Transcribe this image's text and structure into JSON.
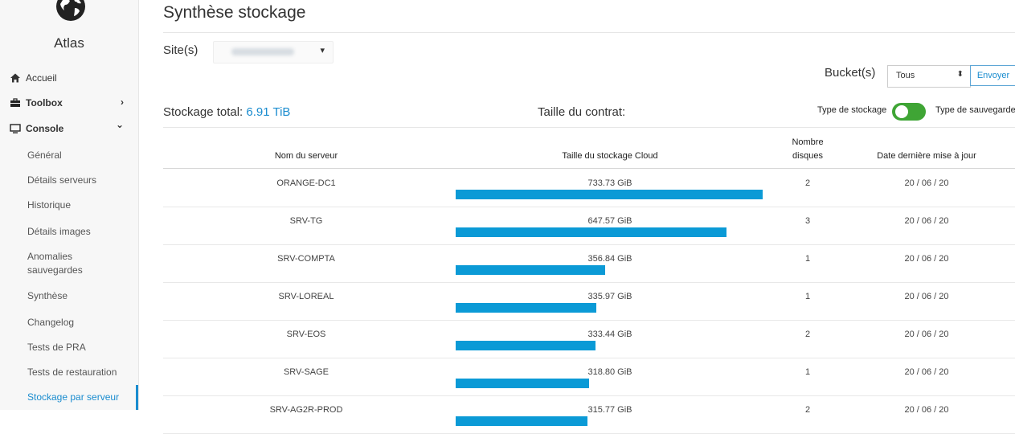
{
  "app": {
    "name": "Atlas",
    "logo_icon": "globe-icon"
  },
  "sidebar": {
    "top_items": [
      {
        "label": "Accueil",
        "icon": "home-icon"
      },
      {
        "label": "Toolbox",
        "icon": "briefcase-icon",
        "chevron": "›"
      },
      {
        "label": "Console",
        "icon": "monitor-icon",
        "chevron": "⌄"
      }
    ],
    "sub_items": [
      "Général",
      "Détails serveurs",
      "Historique",
      "Détails images",
      "Anomalies sauvegardes",
      "Synthèse",
      "Changelog",
      "Tests de PRA",
      "Tests de restauration",
      "Stockage par serveur"
    ],
    "active_index": 9
  },
  "page": {
    "title": "Synthèse stockage"
  },
  "site": {
    "label": "Site(s)",
    "caret": "▾"
  },
  "bucket": {
    "label": "Bucket(s)",
    "selected": "Tous",
    "caret": "⬍",
    "submit": "Envoyer"
  },
  "summary": {
    "total_label": "Stockage total: ",
    "total_value": "6.91 TiB",
    "contract_label": "Taille du contrat:",
    "toggle_left": "Type de stockage",
    "toggle_right": "Type de sauvegarde",
    "toggle_on": true
  },
  "colors": {
    "accent": "#1a8ccf",
    "bar": "#0b9ad6",
    "toggle": "#3fa535"
  },
  "table": {
    "headers": {
      "name": "Nom du serveur",
      "size": "Taille du stockage Cloud",
      "disks_line1": "Nombre",
      "disks_line2": "disques",
      "date": "Date dernière mise à jour"
    },
    "max_gib": 733.73,
    "rows": [
      {
        "name": "ORANGE-DC1",
        "size": "733.73 GiB",
        "gib": 733.73,
        "disks": "2",
        "date": "20 / 06 / 20"
      },
      {
        "name": "SRV-TG",
        "size": "647.57 GiB",
        "gib": 647.57,
        "disks": "3",
        "date": "20 / 06 / 20"
      },
      {
        "name": "SRV-COMPTA",
        "size": "356.84 GiB",
        "gib": 356.84,
        "disks": "1",
        "date": "20 / 06 / 20"
      },
      {
        "name": "SRV-LOREAL",
        "size": "335.97 GiB",
        "gib": 335.97,
        "disks": "1",
        "date": "20 / 06 / 20"
      },
      {
        "name": "SRV-EOS",
        "size": "333.44 GiB",
        "gib": 333.44,
        "disks": "2",
        "date": "20 / 06 / 20"
      },
      {
        "name": "SRV-SAGE",
        "size": "318.80 GiB",
        "gib": 318.8,
        "disks": "1",
        "date": "20 / 06 / 20"
      },
      {
        "name": "SRV-AG2R-PROD",
        "size": "315.77 GiB",
        "gib": 315.77,
        "disks": "2",
        "date": "20 / 06 / 20"
      }
    ]
  }
}
